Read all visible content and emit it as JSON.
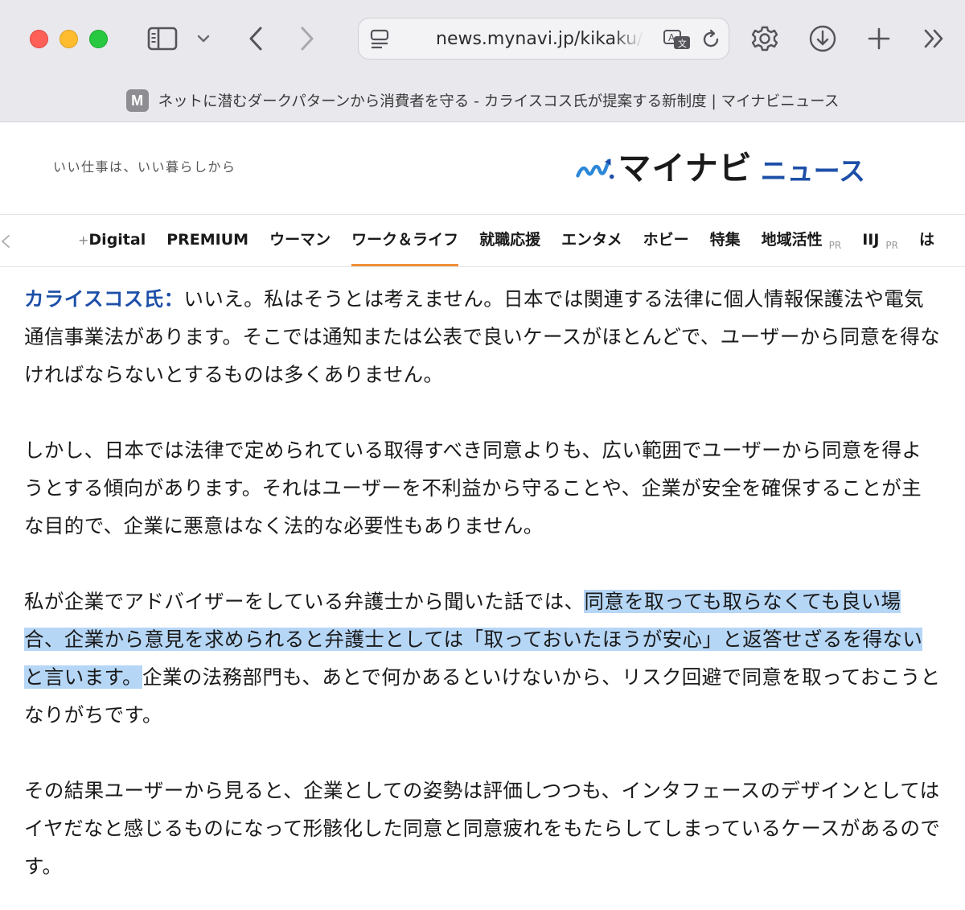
{
  "browser": {
    "url": "news.mynavi.jp/kikaku/",
    "tab_title": "ネットに潜むダークパターンから消費者を守る - カライスコス氏が提案する新制度 | マイナビニュース",
    "favicon_letter": "M",
    "icons": {
      "sidebar": "sidebar-icon",
      "chevron": "chevron-down-icon",
      "back": "chevron-left-icon",
      "forward": "chevron-right-icon",
      "page": "page-menu-icon",
      "translate": "translate-icon",
      "reload": "reload-icon",
      "settings": "gear-icon",
      "download": "download-icon",
      "new_tab": "plus-icon",
      "overflow": "double-chevron-right-icon"
    }
  },
  "site": {
    "tagline": "いい仕事は、いい暮らしから",
    "logo_brand": "マイナビ",
    "logo_sub": "ニュース",
    "colors": {
      "brand_blue": "#1d4fa8",
      "accent_orange": "#f0903a",
      "highlight": "#b6d6f6"
    }
  },
  "nav": {
    "items": [
      {
        "plus": "+",
        "label": "Digital"
      },
      {
        "label": "PREMIUM"
      },
      {
        "label": "ウーマン"
      },
      {
        "label": "ワーク＆ライフ",
        "active": true
      },
      {
        "label": "就職応援"
      },
      {
        "label": "エンタメ"
      },
      {
        "label": "ホビー"
      },
      {
        "label": "特集"
      },
      {
        "label": "地域活性",
        "pr": "PR"
      },
      {
        "label": "IIJ",
        "pr": "PR"
      },
      {
        "label": "は"
      }
    ]
  },
  "article": {
    "p1": {
      "speaker": "カライスコス氏：",
      "text": "いいえ。私はそうとは考えません。日本では関連する法律に個人情報保護法や電気通信事業法があります。そこでは通知または公表で良いケースがほとんどで、ユーザーから同意を得なければならないとするものは多くありません。"
    },
    "p2": "しかし、日本では法律で定められている取得すべき同意よりも、広い範囲でユーザーから同意を得ようとする傾向があります。それはユーザーを不利益から守ることや、企業が安全を確保することが主な目的で、企業に悪意はなく法的な必要性もありません。",
    "p3": {
      "before": "私が企業でアドバイザーをしている弁護士から聞いた話では、",
      "highlight": "同意を取っても取らなくても良い場合、企業から意見を求められると弁護士としては「取っておいたほうが安心」と返答せざるを得ないと言います。",
      "after": "企業の法務部門も、あとで何かあるといけないから、リスク回避で同意を取っておこうとなりがちです。"
    },
    "p4": "その結果ユーザーから見ると、企業としての姿勢は評価しつつも、インタフェースのデザインとしてはイヤだなと感じるものになって形骸化した同意と同意疲れをもたらしてしまっているケースがあるのです。"
  }
}
